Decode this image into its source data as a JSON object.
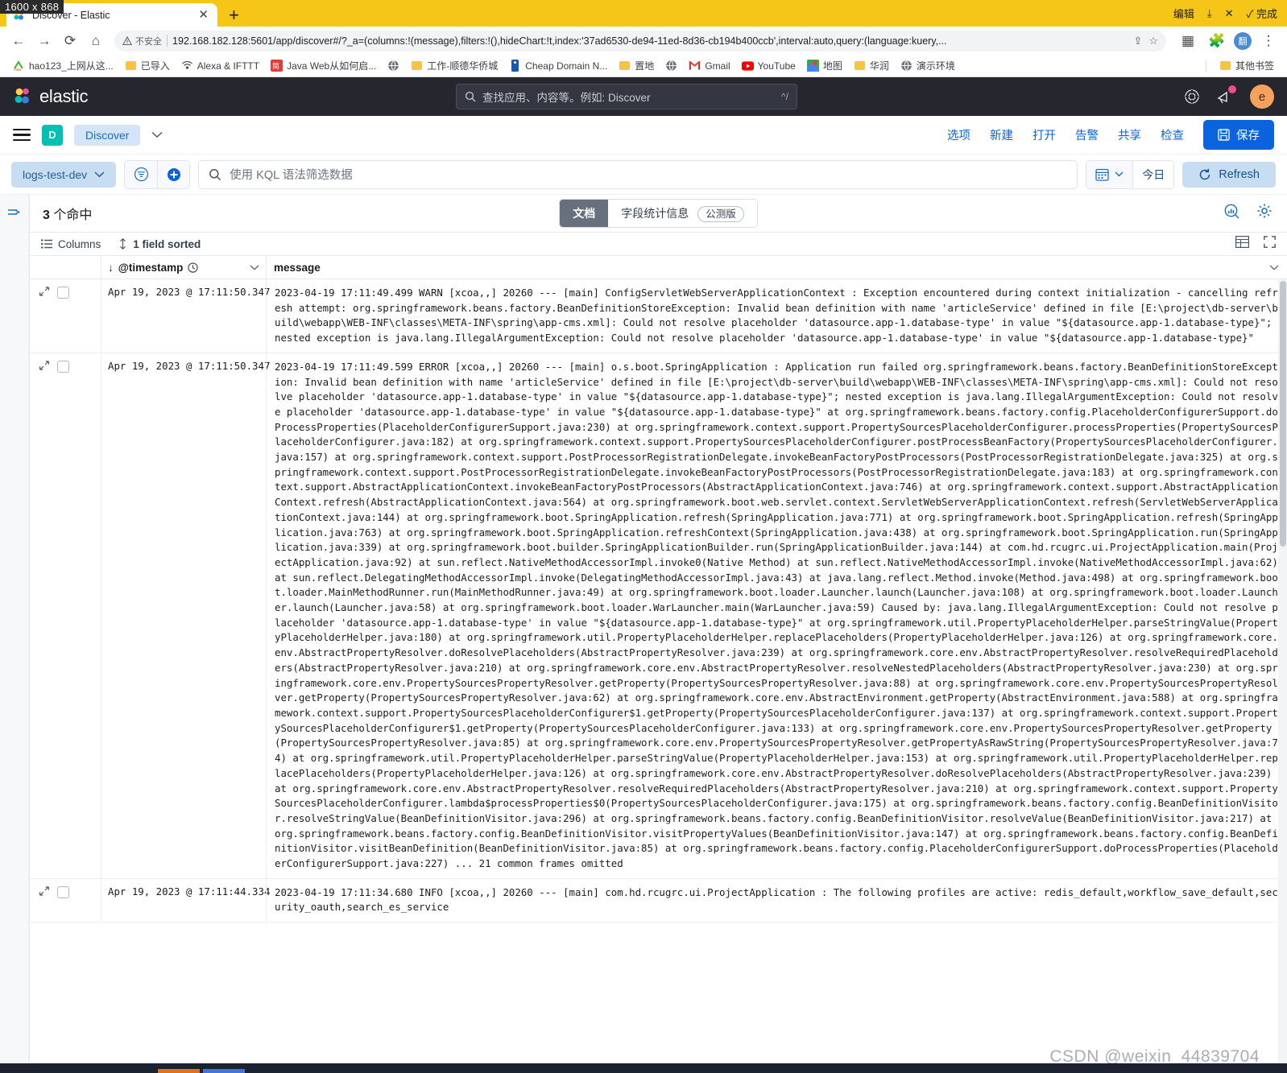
{
  "browser": {
    "size_badge": "1600 x 868",
    "tab_title": "Discover - Elastic",
    "tab_close": "✕",
    "new_tab": "+",
    "window_controls": [
      "编辑",
      "⤓",
      "✕",
      "✓ 完成"
    ],
    "nav": {
      "back": "←",
      "forward": "→",
      "reload": "⟳",
      "home": "⌂",
      "security_label": "不安全",
      "url": "192.168.182.128:5601/app/discover#/?_a=(columns:!(message),filters:!(),hideChart:!t,index:'37ad6530-de94-11ed-8d36-cb194b400ccb',interval:auto,query:(language:kuery,...",
      "share_icon": "⇪",
      "star_icon": "☆",
      "ext_icon": "▦",
      "puzzle_icon": "🧩",
      "profile_letter": "翻",
      "menu_icon": "⋮"
    },
    "bookmarks": [
      {
        "label": "hao123_上网从这...",
        "icon": "hao"
      },
      {
        "label": "已导入",
        "icon": "folder"
      },
      {
        "label": "Alexa & IFTTT",
        "icon": "wifi"
      },
      {
        "label": "Java Web从如何启...",
        "icon": "jian"
      },
      {
        "label": "",
        "icon": "globe"
      },
      {
        "label": "工作-顺德华侨城",
        "icon": "folder"
      },
      {
        "label": "Cheap Domain N...",
        "icon": "blue"
      },
      {
        "label": "置地",
        "icon": "folder"
      },
      {
        "label": "",
        "icon": "globe"
      },
      {
        "label": "Gmail",
        "icon": "gmail"
      },
      {
        "label": "YouTube",
        "icon": "youtube"
      },
      {
        "label": "地图",
        "icon": "maps"
      },
      {
        "label": "华润",
        "icon": "folder"
      },
      {
        "label": "演示环境",
        "icon": "globe"
      }
    ],
    "other_bookmarks": {
      "label": "其他书签",
      "icon": "folder"
    }
  },
  "elastic": {
    "brand": "elastic",
    "global_search": {
      "placeholder": "查找应用、内容等。例如: Discover",
      "shortcut": "^/"
    },
    "header_icons": [
      "help-icon",
      "news-icon"
    ],
    "avatar_letter": "e",
    "nav": {
      "app_badge": "D",
      "breadcrumb": "Discover",
      "links": [
        "选项",
        "新建",
        "打开",
        "告警",
        "共享",
        "检查"
      ],
      "save_label": "保存"
    },
    "query_bar": {
      "datasource": "logs-test-dev",
      "kql_placeholder": "使用 KQL 语法筛选数据",
      "today_label": "今日",
      "refresh_label": "Refresh"
    },
    "hits": {
      "count": "3",
      "label": "个命中",
      "full": "3 个命中"
    },
    "view_tabs": {
      "documents": "文档",
      "field_stats": "字段统计信息",
      "beta": "公测版"
    },
    "grid_toolbar": {
      "columns": "Columns",
      "sorted": "1 field sorted"
    },
    "grid_columns": {
      "timestamp": "@timestamp",
      "message": "message",
      "sort_arrow": "↓"
    },
    "rows": [
      {
        "timestamp": "Apr 19, 2023 @ 17:11:50.347",
        "message": "2023-04-19 17:11:49.499 WARN [xcoa,,] 20260 --- [main] ConfigServletWebServerApplicationContext : Exception encountered during context initialization - cancelling refresh attempt: org.springframework.beans.factory.BeanDefinitionStoreException: Invalid bean definition with name 'articleService' defined in file [E:\\project\\db-server\\build\\webapp\\WEB-INF\\classes\\META-INF\\spring\\app-cms.xml]: Could not resolve placeholder 'datasource.app-1.database-type' in value \"${datasource.app-1.database-type}\"; nested exception is java.lang.IllegalArgumentException: Could not resolve placeholder 'datasource.app-1.database-type' in value \"${datasource.app-1.database-type}\""
      },
      {
        "timestamp": "Apr 19, 2023 @ 17:11:50.347",
        "message": "2023-04-19 17:11:49.599 ERROR [xcoa,,] 20260 --- [main] o.s.boot.SpringApplication : Application run failed org.springframework.beans.factory.BeanDefinitionStoreException: Invalid bean definition with name 'articleService' defined in file [E:\\project\\db-server\\build\\webapp\\WEB-INF\\classes\\META-INF\\spring\\app-cms.xml]: Could not resolve placeholder 'datasource.app-1.database-type' in value \"${datasource.app-1.database-type}\"; nested exception is java.lang.IllegalArgumentException: Could not resolve placeholder 'datasource.app-1.database-type' in value \"${datasource.app-1.database-type}\" at org.springframework.beans.factory.config.PlaceholderConfigurerSupport.doProcessProperties(PlaceholderConfigurerSupport.java:230) at org.springframework.context.support.PropertySourcesPlaceholderConfigurer.processProperties(PropertySourcesPlaceholderConfigurer.java:182) at org.springframework.context.support.PropertySourcesPlaceholderConfigurer.postProcessBeanFactory(PropertySourcesPlaceholderConfigurer.java:157) at org.springframework.context.support.PostProcessorRegistrationDelegate.invokeBeanFactoryPostProcessors(PostProcessorRegistrationDelegate.java:325) at org.springframework.context.support.PostProcessorRegistrationDelegate.invokeBeanFactoryPostProcessors(PostProcessorRegistrationDelegate.java:183) at org.springframework.context.support.AbstractApplicationContext.invokeBeanFactoryPostProcessors(AbstractApplicationContext.java:746) at org.springframework.context.support.AbstractApplicationContext.refresh(AbstractApplicationContext.java:564) at org.springframework.boot.web.servlet.context.ServletWebServerApplicationContext.refresh(ServletWebServerApplicationContext.java:144) at org.springframework.boot.SpringApplication.refresh(SpringApplication.java:771) at org.springframework.boot.SpringApplication.refresh(SpringApplication.java:763) at org.springframework.boot.SpringApplication.refreshContext(SpringApplication.java:438) at org.springframework.boot.SpringApplication.run(SpringApplication.java:339) at org.springframework.boot.builder.SpringApplicationBuilder.run(SpringApplicationBuilder.java:144) at com.hd.rcugrc.ui.ProjectApplication.main(ProjectApplication.java:92) at sun.reflect.NativeMethodAccessorImpl.invoke0(Native Method) at sun.reflect.NativeMethodAccessorImpl.invoke(NativeMethodAccessorImpl.java:62) at sun.reflect.DelegatingMethodAccessorImpl.invoke(DelegatingMethodAccessorImpl.java:43) at java.lang.reflect.Method.invoke(Method.java:498) at org.springframework.boot.loader.MainMethodRunner.run(MainMethodRunner.java:49) at org.springframework.boot.loader.Launcher.launch(Launcher.java:108) at org.springframework.boot.loader.Launcher.launch(Launcher.java:58) at org.springframework.boot.loader.WarLauncher.main(WarLauncher.java:59) Caused by: java.lang.IllegalArgumentException: Could not resolve placeholder 'datasource.app-1.database-type' in value \"${datasource.app-1.database-type}\" at org.springframework.util.PropertyPlaceholderHelper.parseStringValue(PropertyPlaceholderHelper.java:180) at org.springframework.util.PropertyPlaceholderHelper.replacePlaceholders(PropertyPlaceholderHelper.java:126) at org.springframework.core.env.AbstractPropertyResolver.doResolvePlaceholders(AbstractPropertyResolver.java:239) at org.springframework.core.env.AbstractPropertyResolver.resolveRequiredPlaceholders(AbstractPropertyResolver.java:210) at org.springframework.core.env.AbstractPropertyResolver.resolveNestedPlaceholders(AbstractPropertyResolver.java:230) at org.springframework.core.env.PropertySourcesPropertyResolver.getProperty(PropertySourcesPropertyResolver.java:88) at org.springframework.core.env.PropertySourcesPropertyResolver.getProperty(PropertySourcesPropertyResolver.java:62) at org.springframework.core.env.AbstractEnvironment.getProperty(AbstractEnvironment.java:588) at org.springframework.context.support.PropertySourcesPlaceholderConfigurer$1.getProperty(PropertySourcesPlaceholderConfigurer.java:137) at org.springframework.context.support.PropertySourcesPlaceholderConfigurer$1.getProperty(PropertySourcesPlaceholderConfigurer.java:133) at org.springframework.core.env.PropertySourcesPropertyResolver.getProperty(PropertySourcesPropertyResolver.java:85) at org.springframework.core.env.PropertySourcesPropertyResolver.getPropertyAsRawString(PropertySourcesPropertyResolver.java:74) at org.springframework.util.PropertyPlaceholderHelper.parseStringValue(PropertyPlaceholderHelper.java:153) at org.springframework.util.PropertyPlaceholderHelper.replacePlaceholders(PropertyPlaceholderHelper.java:126) at org.springframework.core.env.AbstractPropertyResolver.doResolvePlaceholders(AbstractPropertyResolver.java:239) at org.springframework.core.env.AbstractPropertyResolver.resolveRequiredPlaceholders(AbstractPropertyResolver.java:210) at org.springframework.context.support.PropertySourcesPlaceholderConfigurer.lambda$processProperties$0(PropertySourcesPlaceholderConfigurer.java:175) at org.springframework.beans.factory.config.BeanDefinitionVisitor.resolveStringValue(BeanDefinitionVisitor.java:296) at org.springframework.beans.factory.config.BeanDefinitionVisitor.resolveValue(BeanDefinitionVisitor.java:217) at org.springframework.beans.factory.config.BeanDefinitionVisitor.visitPropertyValues(BeanDefinitionVisitor.java:147) at org.springframework.beans.factory.config.BeanDefinitionVisitor.visitBeanDefinition(BeanDefinitionVisitor.java:85) at org.springframework.beans.factory.config.PlaceholderConfigurerSupport.doProcessProperties(PlaceholderConfigurerSupport.java:227) ... 21 common frames omitted"
      },
      {
        "timestamp": "Apr 19, 2023 @ 17:11:44.334",
        "message": "2023-04-19 17:11:34.680 INFO [xcoa,,] 20260 --- [main] com.hd.rcugrc.ui.ProjectApplication : The following profiles are active: redis_default,workflow_save_default,security_oauth,search_es_service"
      }
    ],
    "watermark": "CSDN @weixin_44839704"
  },
  "colors": {
    "accent": "#0b64dd",
    "elastic_dark": "#25262e",
    "tab_yellow": "#f5c518",
    "teal": "#00bfb3"
  }
}
